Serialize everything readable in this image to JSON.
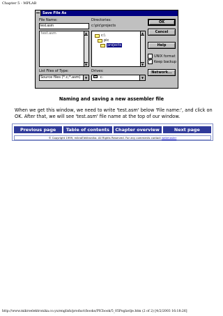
{
  "page_header": "Chapter 5 - MPLAB",
  "dialog": {
    "title": "Save File As",
    "file_name_label": "File Name:",
    "file_name_value": "test.asm",
    "file_list": [
      "test.asm"
    ],
    "directories_label": "Directories:",
    "directories_path": "c:\\pic\\projects",
    "dir_tree": [
      "c:\\",
      "pic",
      "projects"
    ],
    "list_type_label": "List Files of Type:",
    "list_type_value": "Source files (*.c;*.asm)",
    "drives_label": "Drives:",
    "drives_value": "c:",
    "buttons": {
      "ok": "OK",
      "cancel": "Cancel",
      "help": "Help",
      "network": "Network..."
    },
    "checkboxes": [
      {
        "label": "UNIX format",
        "checked": false
      },
      {
        "label": "Keep backup",
        "checked": true
      }
    ]
  },
  "caption": "Naming and saving a new assembler file",
  "paragraph": "When we get this window, we need to write 'test.asm' below 'File name:', and click on OK. After that, we will see 'test.asm' file name at the top of our window.",
  "nav": {
    "previous": "Previous page",
    "contents": "Table of contents",
    "overview": "Chapter overview",
    "next": "Next page"
  },
  "copyright": {
    "text": "© Copyright 1999, mikroElektronika. All Rights Reserved. For any comments contact",
    "link": "webmaster"
  },
  "footer": "http://www.mikroelektronika.co.yu/english/product/books/PICbook/5_05Poglavlje.htm (2 of 2) [4/2/2003 16:18:26]"
}
